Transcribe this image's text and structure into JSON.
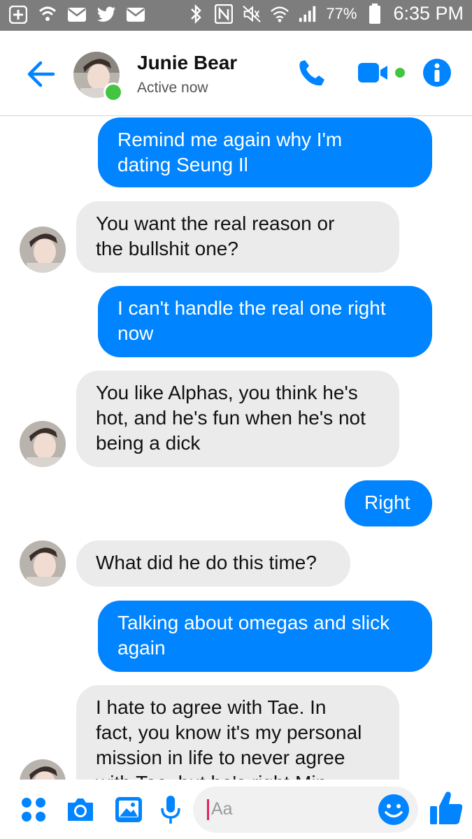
{
  "status_bar": {
    "battery_percent": "77%",
    "time": "6:35 PM"
  },
  "header": {
    "contact_name": "Junie Bear",
    "contact_status": "Active now"
  },
  "colors": {
    "accent": "#0084ff",
    "incoming_bubble": "#ebebeb",
    "presence": "#44c542",
    "status_bar": "#7d7d7d"
  },
  "messages": [
    {
      "direction": "out",
      "lines": [
        "Remind me again why I'm",
        "dating Seung Il"
      ]
    },
    {
      "direction": "in",
      "lines": [
        "You want the real reason or",
        "the bullshit one?"
      ]
    },
    {
      "direction": "out",
      "lines": [
        "I can't handle the real one right",
        "now"
      ]
    },
    {
      "direction": "in",
      "lines": [
        "You like Alphas, you think he's",
        "hot, and he's fun when he's not",
        "being a dick"
      ]
    },
    {
      "direction": "out",
      "lines": [
        "Right"
      ]
    },
    {
      "direction": "in",
      "lines": [
        "What did he do this time?"
      ]
    },
    {
      "direction": "out",
      "lines": [
        "Talking about omegas and slick",
        "again"
      ]
    },
    {
      "direction": "in",
      "lines": [
        "I hate to agree with Tae. In",
        "fact, you know it's my personal",
        "mission in life to never agree",
        "with Tae, but he's right Min"
      ]
    }
  ],
  "composer": {
    "placeholder": "Aa"
  },
  "icons": {
    "status_bar": [
      "add-icon",
      "wifi-calling-icon",
      "mail-icon",
      "twitter-icon",
      "mail-icon",
      "bluetooth-icon",
      "nfc-icon",
      "mute-icon",
      "wifi-icon",
      "signal-icon",
      "battery-icon"
    ],
    "header": [
      "back-arrow-icon",
      "phone-icon",
      "video-icon",
      "info-icon"
    ],
    "composer": [
      "more-icon",
      "camera-icon",
      "gallery-icon",
      "microphone-icon",
      "emoji-icon",
      "thumbs-up-icon"
    ]
  }
}
